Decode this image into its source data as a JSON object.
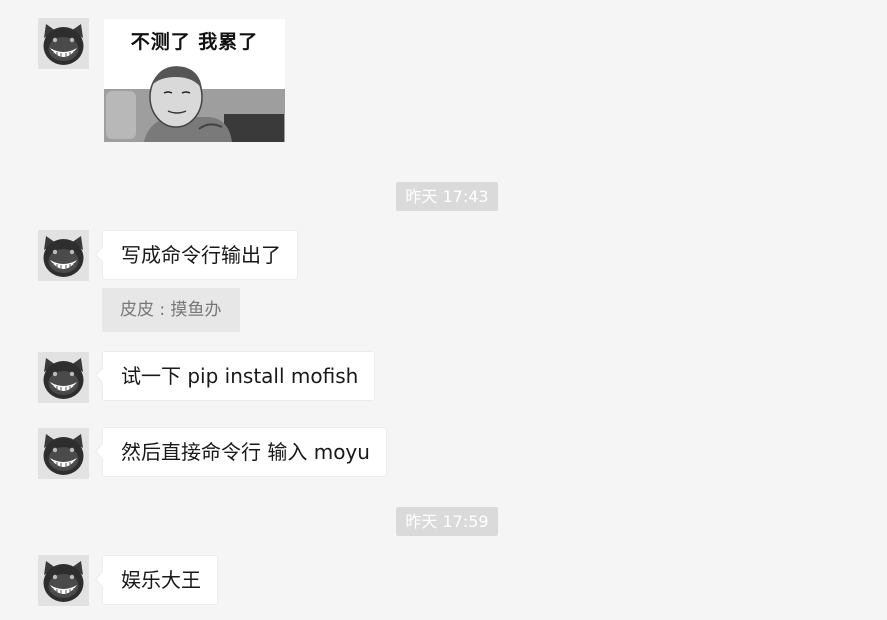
{
  "sticker": {
    "caption": "不测了 我累了",
    "icon": "meme-sticker-image"
  },
  "timestamps": [
    "昨天 17:43",
    "昨天 17:59"
  ],
  "quote": {
    "text": "皮皮 : 摸鱼办"
  },
  "messages": [
    {
      "text": "写成命令行输出了"
    },
    {
      "text": "试一下 pip install mofish"
    },
    {
      "text": "然后直接命令行 输入 moyu"
    },
    {
      "text": "娱乐大王"
    }
  ],
  "colors": {
    "background": "#f5f5f5",
    "bubble": "#ffffff",
    "time_chip": "#dadada",
    "quote_bg": "#e7e7e7"
  }
}
